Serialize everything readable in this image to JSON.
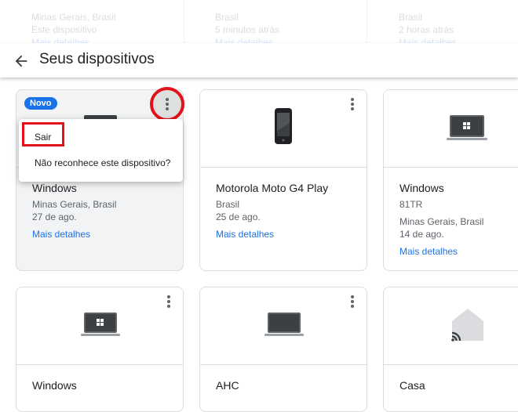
{
  "background_strip": {
    "col1": [
      "Minas Gerais, Brasil",
      "Este dispositivo",
      "Mais detalhes"
    ],
    "col2": [
      "Brasil",
      "5 minutos atrás",
      "Mais detalhes"
    ],
    "col3": [
      "Brasil",
      "2 horas atrás",
      "Mais detalhes"
    ]
  },
  "header": {
    "title": "Seus dispositivos",
    "back_icon": "arrow-back-icon"
  },
  "menu": {
    "sair": "Sair",
    "nao_reconhece": "Não reconhece este dispositivo?"
  },
  "cards": [
    {
      "badge": "Novo",
      "name": "Windows",
      "lines": [
        "Minas Gerais, Brasil",
        "27 de ago."
      ],
      "link": "Mais detalhes",
      "icon": "laptop-icon"
    },
    {
      "name": "Motorola Moto G4 Play",
      "lines": [
        "Brasil",
        "25 de ago."
      ],
      "link": "Mais detalhes",
      "icon": "phone-icon"
    },
    {
      "name": "Windows",
      "lines": [
        "81TR",
        "Minas Gerais, Brasil",
        "14 de ago."
      ],
      "link": "Mais detalhes",
      "icon": "laptop-icon"
    },
    {
      "name": "Windows",
      "icon": "laptop-icon"
    },
    {
      "name": "AHC",
      "icon": "laptop-icon"
    },
    {
      "name": "Casa",
      "icon": "home-cast-icon"
    }
  ],
  "colors": {
    "accent": "#1a73e8",
    "highlight_red": "#e0131b",
    "text": "#202124",
    "secondary_text": "#5f6368"
  }
}
